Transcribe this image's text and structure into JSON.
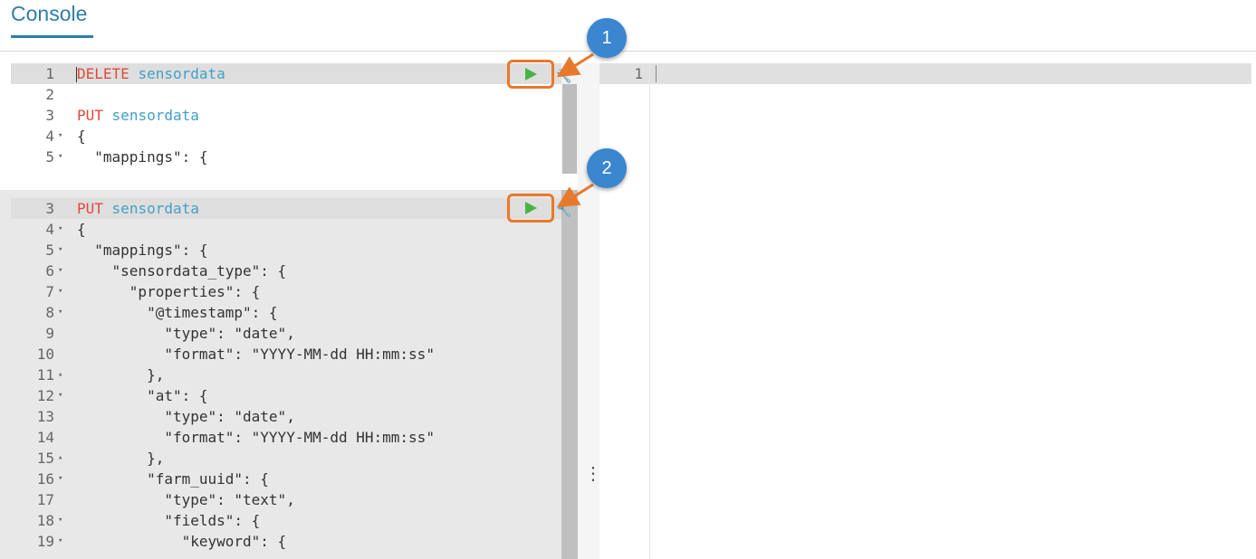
{
  "header": {
    "tab_title": "Console"
  },
  "editor_top": {
    "lines": [
      {
        "num": "1",
        "fold": "",
        "method": "DELETE",
        "path": "sensordata",
        "text": ""
      },
      {
        "num": "2",
        "fold": "",
        "method": "",
        "path": "",
        "text": ""
      },
      {
        "num": "3",
        "fold": "",
        "method": "PUT",
        "path": "sensordata",
        "text": ""
      },
      {
        "num": "4",
        "fold": "▾",
        "method": "",
        "path": "",
        "text": "{"
      },
      {
        "num": "5",
        "fold": "▾",
        "method": "",
        "path": "",
        "text": "  \"mappings\": {"
      }
    ]
  },
  "editor_bottom": {
    "lines": [
      {
        "num": "3",
        "fold": "",
        "method": "PUT",
        "path": "sensordata",
        "text": ""
      },
      {
        "num": "4",
        "fold": "▾",
        "method": "",
        "path": "",
        "text": "{"
      },
      {
        "num": "5",
        "fold": "▾",
        "method": "",
        "path": "",
        "text": "  \"mappings\": {"
      },
      {
        "num": "6",
        "fold": "▾",
        "method": "",
        "path": "",
        "text": "    \"sensordata_type\": {"
      },
      {
        "num": "7",
        "fold": "▾",
        "method": "",
        "path": "",
        "text": "      \"properties\": {"
      },
      {
        "num": "8",
        "fold": "▾",
        "method": "",
        "path": "",
        "text": "        \"@timestamp\": {"
      },
      {
        "num": "9",
        "fold": "",
        "method": "",
        "path": "",
        "text": "          \"type\": \"date\","
      },
      {
        "num": "10",
        "fold": "",
        "method": "",
        "path": "",
        "text": "          \"format\": \"YYYY-MM-dd HH:mm:ss\""
      },
      {
        "num": "11",
        "fold": "▴",
        "method": "",
        "path": "",
        "text": "        },"
      },
      {
        "num": "12",
        "fold": "▾",
        "method": "",
        "path": "",
        "text": "        \"at\": {"
      },
      {
        "num": "13",
        "fold": "",
        "method": "",
        "path": "",
        "text": "          \"type\": \"date\","
      },
      {
        "num": "14",
        "fold": "",
        "method": "",
        "path": "",
        "text": "          \"format\": \"YYYY-MM-dd HH:mm:ss\""
      },
      {
        "num": "15",
        "fold": "▴",
        "method": "",
        "path": "",
        "text": "        },"
      },
      {
        "num": "16",
        "fold": "▾",
        "method": "",
        "path": "",
        "text": "        \"farm_uuid\": {"
      },
      {
        "num": "17",
        "fold": "",
        "method": "",
        "path": "",
        "text": "          \"type\": \"text\","
      },
      {
        "num": "18",
        "fold": "▾",
        "method": "",
        "path": "",
        "text": "          \"fields\": {"
      },
      {
        "num": "19",
        "fold": "▾",
        "method": "",
        "path": "",
        "text": "            \"keyword\": {"
      }
    ]
  },
  "output": {
    "lines": [
      {
        "num": "1"
      }
    ]
  },
  "callouts": [
    {
      "label": "1"
    },
    {
      "label": "2"
    }
  ],
  "icons": {
    "play": "play-icon",
    "wrench": "wrench-icon",
    "kebab": "kebab-icon"
  },
  "colors": {
    "accent": "#2f7ea8",
    "highlight": "#e8792b",
    "play": "#49b347",
    "callout": "#3a86cf"
  }
}
